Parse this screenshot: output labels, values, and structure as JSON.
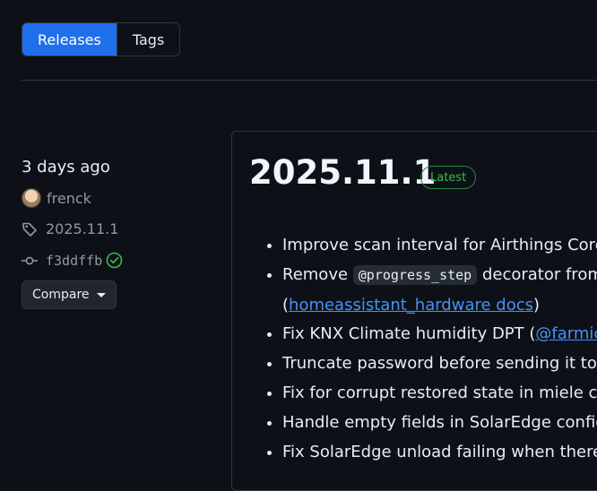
{
  "tabs": {
    "releases": "Releases",
    "tags": "Tags"
  },
  "release": {
    "time_ago": "3 days ago",
    "author": "frenck",
    "tag": "2025.11.1",
    "commit": "f3ddffb",
    "compare_label": "Compare",
    "version": "2025.11.1",
    "badge": "Latest"
  },
  "notes": {
    "n1": "Improve scan interval for Airthings Corentium",
    "n2_pre": "Remove ",
    "n2_code": "@progress_step",
    "n2_post": " decorator from",
    "n2_line2_open": "(",
    "n2_link": "homeassistant_hardware docs",
    "n2_line2_close": ")",
    "n3_pre": "Fix KNX Climate humidity DPT (",
    "n3_link": "@farmio",
    "n3_post": " -",
    "n4": "Truncate password before sending it to b",
    "n5": "Fix for corrupt restored state in miele cor",
    "n6": "Handle empty fields in SolarEdge config f",
    "n7": "Fix SolarEdge unload failing when there a"
  },
  "colors": {
    "accent": "#1f6feb",
    "success": "#3fb950",
    "link": "#4493f8",
    "background": "#0d1117"
  }
}
